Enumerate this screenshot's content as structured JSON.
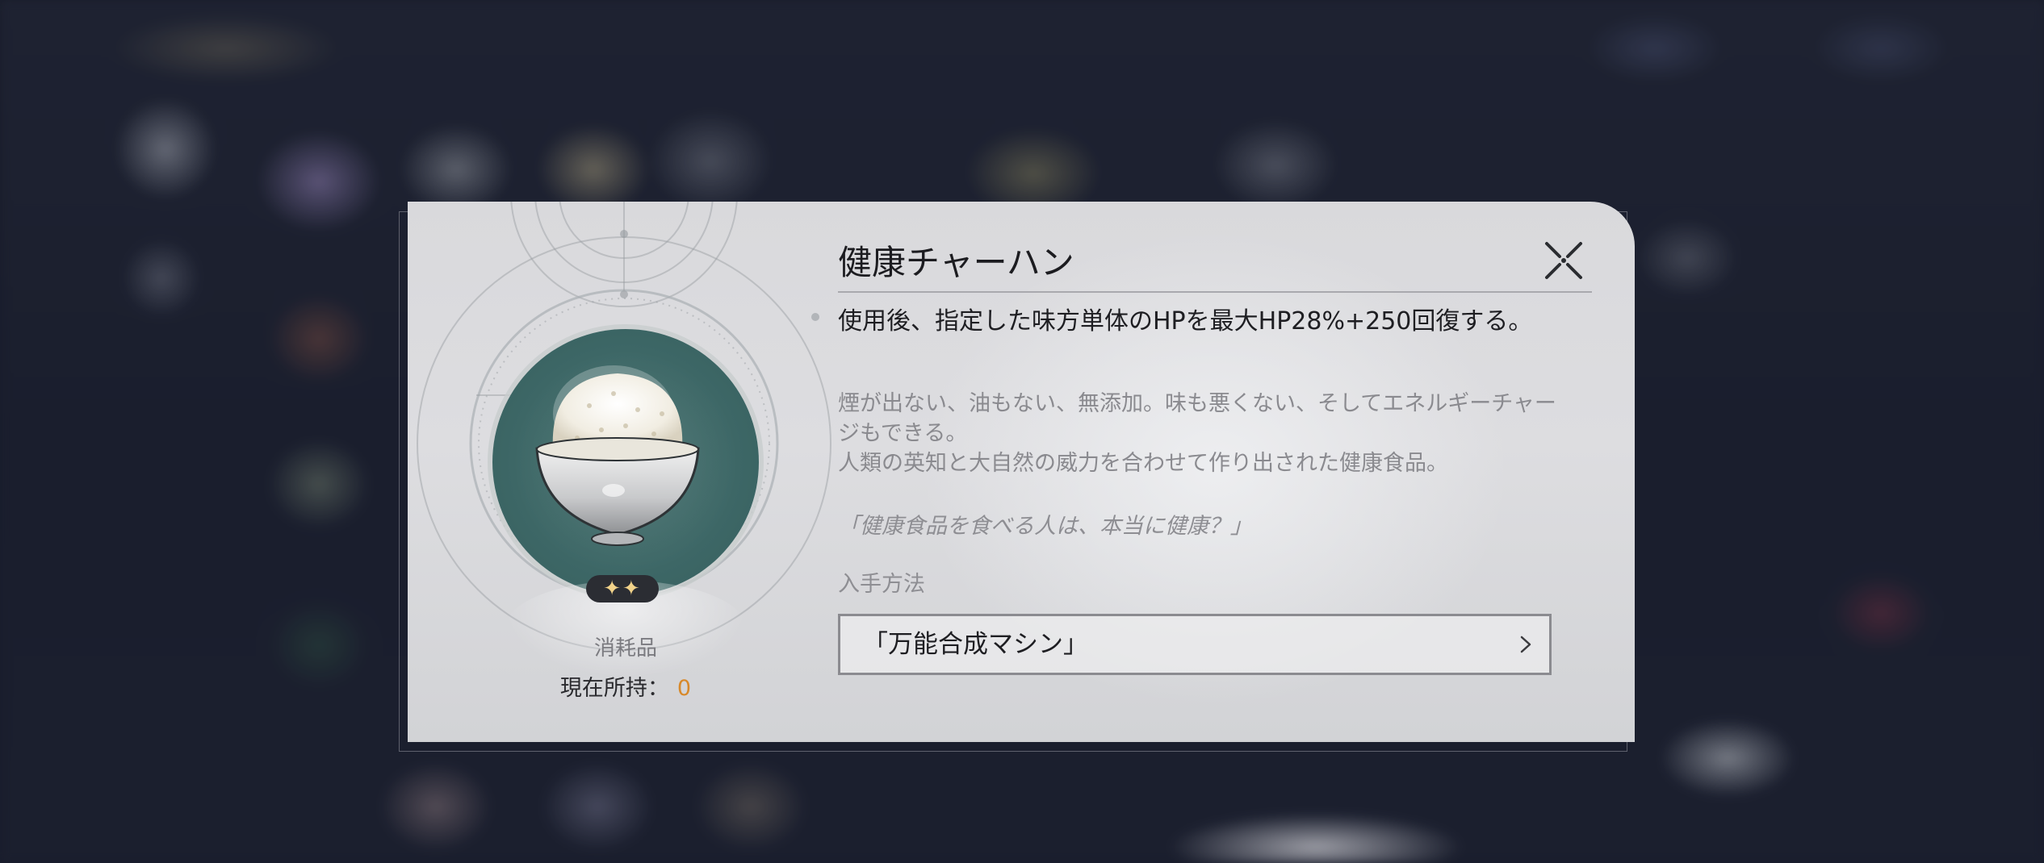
{
  "item": {
    "title": "健康チャーハン",
    "effect": "使用後、指定した味方単体のHPを最大HP28%+250回復する。",
    "description": "煙が出ない、油もない、無添加。味も悪くない、そしてエネルギーチャージもできる。\n人類の英知と大自然の威力を合わせて作り出された健康食品。",
    "quote": "「健康食品を食べる人は、本当に健康？」",
    "category": "消耗品",
    "rarity_stars": "✦✦",
    "owned_label": "現在所持：",
    "owned_count": "0"
  },
  "source": {
    "heading": "入手方法",
    "items": [
      {
        "label": "「万能合成マシン」"
      }
    ]
  },
  "icons": {
    "close": "close-x-icon",
    "chevron": "chevron-right-icon",
    "item_image": "fried-rice-bowl-icon"
  },
  "colors": {
    "owned_count": "#d8892a",
    "portrait_bg": "#3d6766",
    "dialog_bg": "#d9d9dc"
  }
}
